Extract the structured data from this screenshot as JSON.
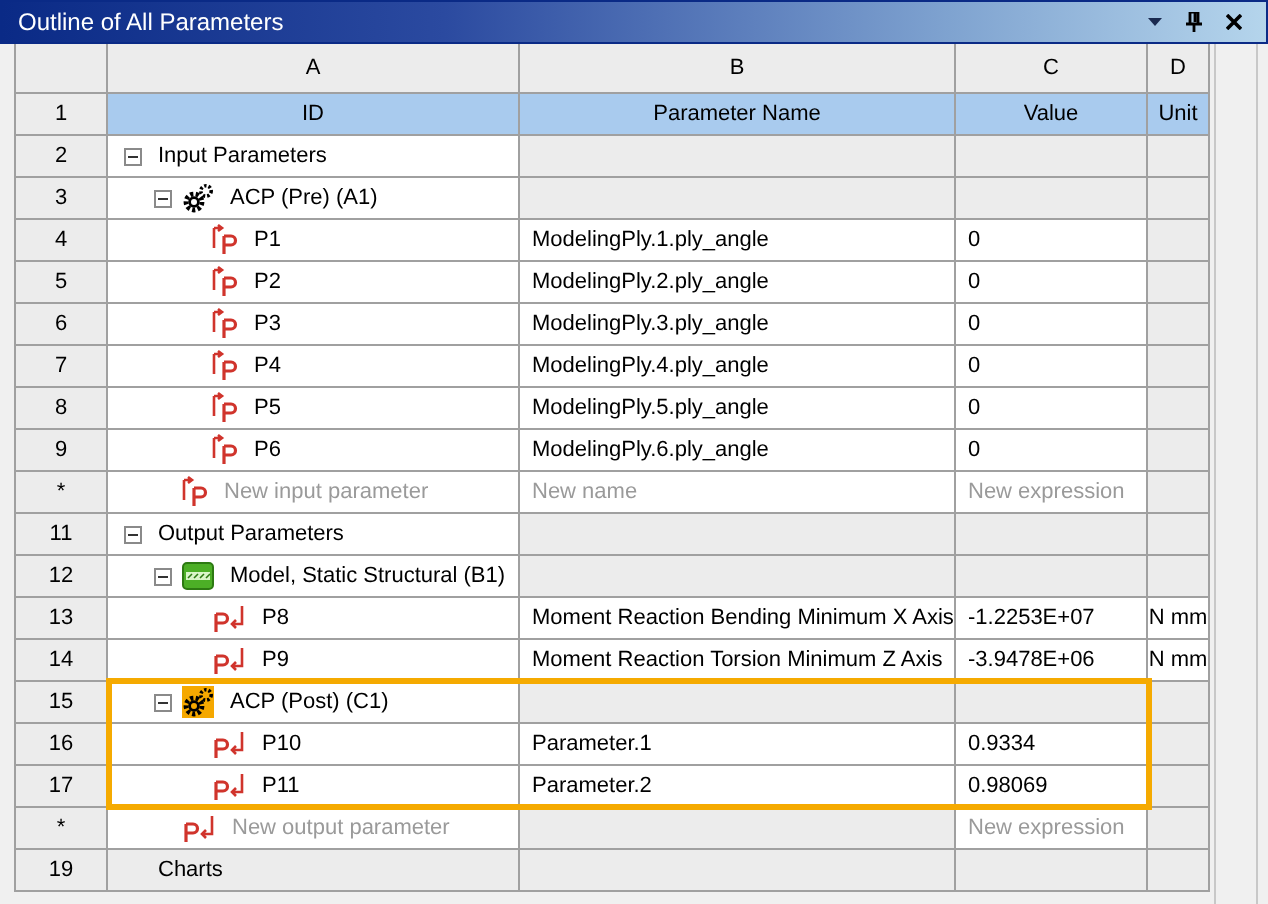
{
  "window": {
    "title": "Outline of All Parameters"
  },
  "columns": [
    {
      "letter": "A",
      "heading": "ID"
    },
    {
      "letter": "B",
      "heading": "Parameter Name"
    },
    {
      "letter": "C",
      "heading": "Value"
    },
    {
      "letter": "D",
      "heading": "Unit"
    }
  ],
  "header_num": "1",
  "tree": [
    {
      "num": "2",
      "label": "Input Parameters",
      "kind": "category",
      "expanded": true,
      "cells": [
        {
          "editable": false
        },
        {
          "editable": false
        },
        {
          "editable": false
        }
      ],
      "children": [
        {
          "num": "3",
          "label": "ACP (Pre) (A1)",
          "kind": "system",
          "expanded": true,
          "cells": [
            {
              "editable": false
            },
            {
              "editable": false
            },
            {
              "editable": false
            }
          ],
          "children": [
            {
              "num": "4",
              "label": "P1",
              "kind": "input",
              "cells": [
                {
                  "text": "ModelingPly.1.ply_angle",
                  "editable": true
                },
                {
                  "text": "0",
                  "editable": true
                },
                {
                  "editable": false
                }
              ]
            },
            {
              "num": "5",
              "label": "P2",
              "kind": "input",
              "cells": [
                {
                  "text": "ModelingPly.2.ply_angle",
                  "editable": true
                },
                {
                  "text": "0",
                  "editable": true
                },
                {
                  "editable": false
                }
              ]
            },
            {
              "num": "6",
              "label": "P3",
              "kind": "input",
              "cells": [
                {
                  "text": "ModelingPly.3.ply_angle",
                  "editable": true
                },
                {
                  "text": "0",
                  "editable": true
                },
                {
                  "editable": false
                }
              ]
            },
            {
              "num": "7",
              "label": "P4",
              "kind": "input",
              "cells": [
                {
                  "text": "ModelingPly.4.ply_angle",
                  "editable": true
                },
                {
                  "text": "0",
                  "editable": true
                },
                {
                  "editable": false
                }
              ]
            },
            {
              "num": "8",
              "label": "P5",
              "kind": "input",
              "cells": [
                {
                  "text": "ModelingPly.5.ply_angle",
                  "editable": true
                },
                {
                  "text": "0",
                  "editable": true
                },
                {
                  "editable": false
                }
              ]
            },
            {
              "num": "9",
              "label": "P6",
              "kind": "input",
              "cells": [
                {
                  "text": "ModelingPly.6.ply_angle",
                  "editable": true
                },
                {
                  "text": "0",
                  "editable": true
                },
                {
                  "editable": false
                }
              ]
            }
          ]
        },
        {
          "num": "*",
          "placeholder": "New input parameter",
          "kind": "input",
          "cells": [
            {
              "placeholder": "New name",
              "editable": true
            },
            {
              "placeholder": "New expression",
              "editable": true
            },
            {
              "editable": false
            }
          ]
        }
      ]
    },
    {
      "num": "11",
      "label": "Output Parameters",
      "kind": "category",
      "expanded": true,
      "cells": [
        {
          "editable": false
        },
        {
          "editable": false
        },
        {
          "editable": false
        }
      ],
      "children": [
        {
          "num": "12",
          "label": "Model, Static Structural (B1)",
          "kind": "model",
          "expanded": true,
          "cells": [
            {
              "editable": false
            },
            {
              "editable": false
            },
            {
              "editable": false
            }
          ],
          "children": [
            {
              "num": "13",
              "label": "P8",
              "kind": "output",
              "cells": [
                {
                  "text": "Moment Reaction Bending Minimum X Axis",
                  "editable": true
                },
                {
                  "text": "-1.2253E+07",
                  "editable": true
                },
                {
                  "text": "N mm",
                  "editable": true
                }
              ]
            },
            {
              "num": "14",
              "label": "P9",
              "kind": "output",
              "cells": [
                {
                  "text": "Moment Reaction Torsion Minimum Z Axis",
                  "editable": true
                },
                {
                  "text": "-3.9478E+06",
                  "editable": true
                },
                {
                  "text": "N mm",
                  "editable": true
                }
              ]
            }
          ]
        },
        {
          "num": "15",
          "label": "ACP (Post) (C1)",
          "kind": "post",
          "expanded": true,
          "highlighted": true,
          "cells": [
            {
              "editable": false
            },
            {
              "editable": false
            },
            {
              "editable": false
            }
          ],
          "children": [
            {
              "num": "16",
              "label": "P10",
              "kind": "output",
              "highlighted": true,
              "cells": [
                {
                  "text": "Parameter.1",
                  "editable": true
                },
                {
                  "text": "0.9334",
                  "editable": true
                },
                {
                  "editable": false
                }
              ]
            },
            {
              "num": "17",
              "label": "P11",
              "kind": "output",
              "highlighted": true,
              "cells": [
                {
                  "text": "Parameter.2",
                  "editable": true
                },
                {
                  "text": "0.98069",
                  "editable": true
                },
                {
                  "editable": false
                }
              ]
            }
          ]
        },
        {
          "num": "*",
          "placeholder": "New output parameter",
          "kind": "output",
          "cells": [
            {
              "editable": false
            },
            {
              "placeholder": "New expression",
              "editable": true
            },
            {
              "editable": false
            }
          ]
        }
      ]
    },
    {
      "num": "19",
      "label": "Charts",
      "kind": "category",
      "cells": [
        {
          "editable": false
        },
        {
          "editable": false
        },
        {
          "editable": false
        }
      ]
    }
  ]
}
